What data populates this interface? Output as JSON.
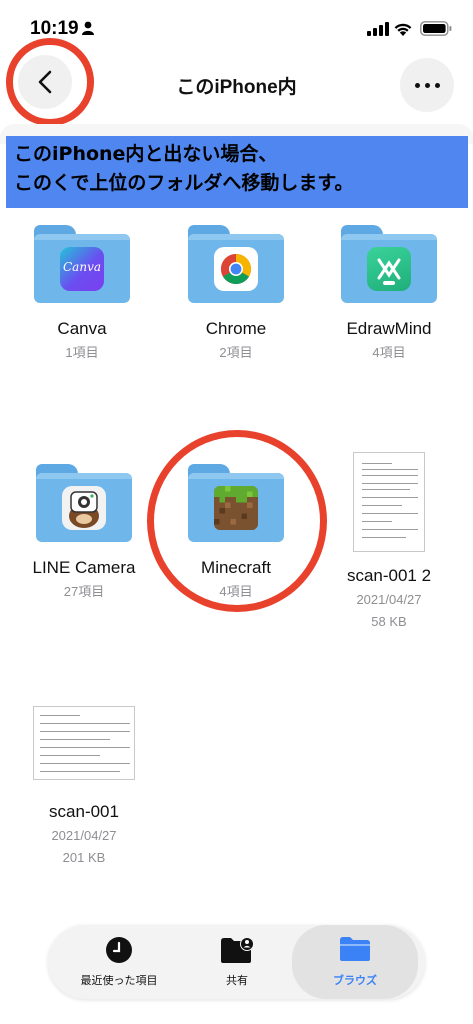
{
  "status": {
    "time": "10:19"
  },
  "nav": {
    "title": "このiPhone内"
  },
  "annotation": {
    "line1": "このiPhone内と出ない場合、",
    "line2": "このくで上位のフォルダへ移動します。"
  },
  "items": [
    {
      "name": "Canva",
      "meta": "1項目",
      "app": "Canva"
    },
    {
      "name": "Chrome",
      "meta": "2項目"
    },
    {
      "name": "EdrawMind",
      "meta": "4項目"
    },
    {
      "name": "LINE Camera",
      "meta": "27項目"
    },
    {
      "name": "Minecraft",
      "meta": "4項目"
    },
    {
      "name": "scan-001 2",
      "date": "2021/04/27",
      "size": "58 KB"
    },
    {
      "name": "scan-001",
      "date": "2021/04/27",
      "size": "201 KB"
    }
  ],
  "tabs": [
    {
      "label": "最近使った項目"
    },
    {
      "label": "共有"
    },
    {
      "label": "ブラウズ"
    }
  ],
  "colors": {
    "accent": "#3b82f6",
    "highlight": "#e8412c",
    "banner": "#4f86f0",
    "folder": "#6fb6ea"
  }
}
